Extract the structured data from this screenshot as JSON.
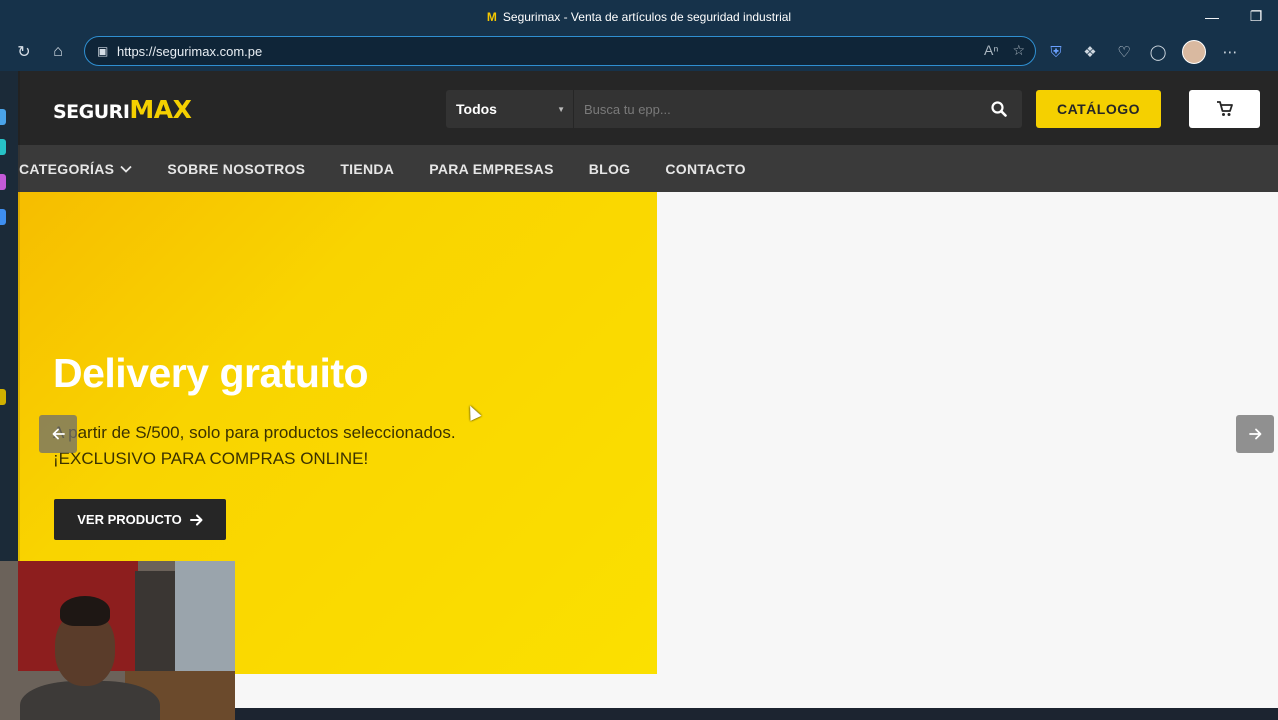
{
  "window": {
    "title": "Segurimax - Venta de artículos de seguridad industrial",
    "favicon": "M"
  },
  "browser": {
    "url": "https://segurimax.com.pe"
  },
  "site": {
    "logo_part1": "SEGURI",
    "logo_part2": "MAX",
    "search": {
      "category": "Todos",
      "placeholder": "Busca tu epp..."
    },
    "catalog_label": "CATÁLOGO",
    "nav": [
      {
        "label": "CATEGORÍAS"
      },
      {
        "label": "SOBRE NOSOTROS"
      },
      {
        "label": "TIENDA"
      },
      {
        "label": "PARA EMPRESAS"
      },
      {
        "label": "BLOG"
      },
      {
        "label": "CONTACTO"
      }
    ]
  },
  "hero": {
    "title": "Delivery gratuito",
    "line1": "A partir de S/500, solo para productos seleccionados.",
    "line2": "¡EXCLUSIVO PARA COMPRAS ONLINE!",
    "button_label": "VER PRODUCTO"
  },
  "colors": {
    "brand_yellow": "#f5d000",
    "header_dark": "#262626",
    "nav_dark": "#3a3a3a"
  }
}
